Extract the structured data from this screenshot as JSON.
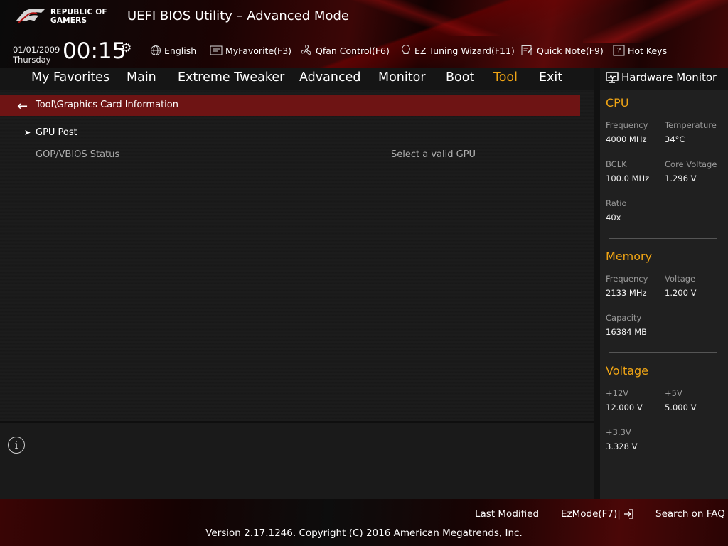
{
  "brand": {
    "line1": "REPUBLIC OF",
    "line2": "GAMERS"
  },
  "app_title": "UEFI BIOS Utility – Advanced Mode",
  "datetime": {
    "date": "01/01/2009",
    "day": "Thursday",
    "time": "00:15"
  },
  "toolbar": {
    "language": "English",
    "my_favorite": "MyFavorite(F3)",
    "qfan": "Qfan Control(F6)",
    "ez_tuning": "EZ Tuning Wizard(F11)",
    "quick_note": "Quick Note(F9)",
    "hot_keys": "Hot Keys"
  },
  "menu": {
    "items": [
      "My Favorites",
      "Main",
      "Extreme Tweaker",
      "Advanced",
      "Monitor",
      "Boot",
      "Tool",
      "Exit"
    ],
    "active": "Tool"
  },
  "content": {
    "path": "Tool\\Graphics Card Information",
    "gpu_post": "GPU Post",
    "gop_label": "GOP/VBIOS Status",
    "gop_value": "Select a valid GPU"
  },
  "hw_monitor": {
    "title": "Hardware Monitor",
    "cpu": {
      "title": "CPU",
      "frequency_label": "Frequency",
      "frequency": "4000 MHz",
      "temperature_label": "Temperature",
      "temperature": "34°C",
      "bclk_label": "BCLK",
      "bclk": "100.0 MHz",
      "core_voltage_label": "Core Voltage",
      "core_voltage": "1.296 V",
      "ratio_label": "Ratio",
      "ratio": "40x"
    },
    "memory": {
      "title": "Memory",
      "frequency_label": "Frequency",
      "frequency": "2133 MHz",
      "voltage_label": "Voltage",
      "voltage": "1.200 V",
      "capacity_label": "Capacity",
      "capacity": "16384 MB"
    },
    "voltage": {
      "title": "Voltage",
      "v12_label": "+12V",
      "v12": "12.000 V",
      "v5_label": "+5V",
      "v5": "5.000 V",
      "v33_label": "+3.3V",
      "v33": "3.328 V"
    }
  },
  "footer": {
    "last_modified": "Last Modified",
    "ez_mode": "EzMode(F7)|",
    "search_faq": "Search on FAQ",
    "version": "Version 2.17.1246. Copyright (C) 2016 American Megatrends, Inc."
  },
  "colors": {
    "accent": "#f0a515",
    "path_bar": "#6e1414",
    "brand_red": "#b00f0f"
  },
  "icons": [
    "rog-logo-icon",
    "gear-icon",
    "globe-icon",
    "favorite-icon",
    "fan-icon",
    "bulb-icon",
    "note-icon",
    "help-icon",
    "back-arrow-icon",
    "chevron-right-icon",
    "info-icon",
    "monitor-icon",
    "exit-icon"
  ]
}
